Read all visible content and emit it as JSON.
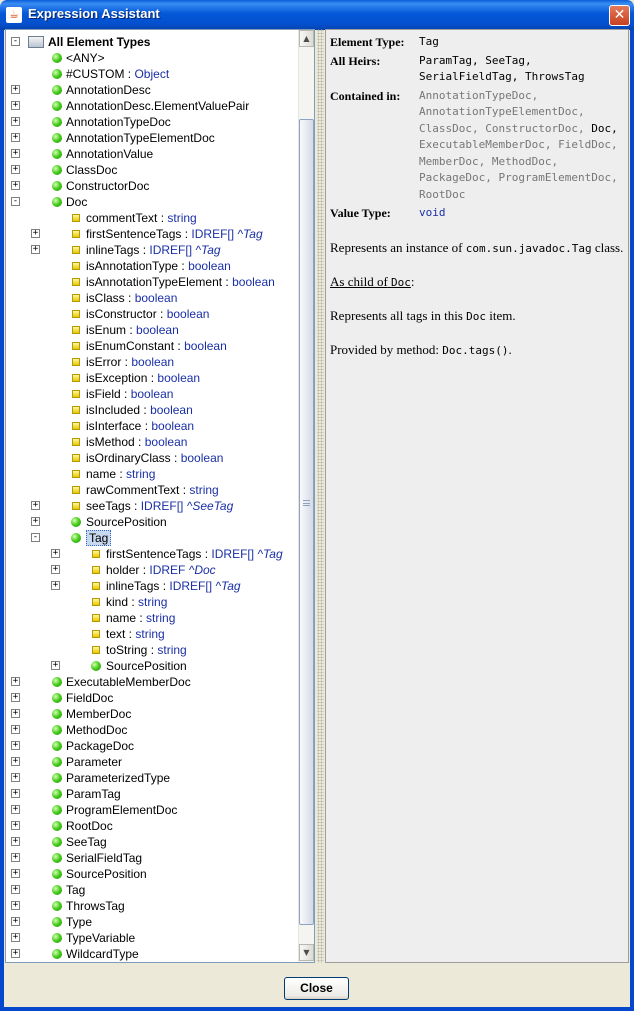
{
  "window": {
    "title": "Expression Assistant",
    "close_glyph": "✕"
  },
  "tree": {
    "root_label": "All Element Types",
    "rows": [
      {
        "indent": 1,
        "icon": "dot",
        "exp": "",
        "name": "<ANY>",
        "type": ""
      },
      {
        "indent": 1,
        "icon": "dot",
        "exp": "",
        "name": "#CUSTOM",
        "type": "Object"
      },
      {
        "indent": 1,
        "icon": "dot",
        "exp": "+",
        "name": "AnnotationDesc",
        "type": ""
      },
      {
        "indent": 1,
        "icon": "dot",
        "exp": "+",
        "name": "AnnotationDesc.ElementValuePair",
        "type": ""
      },
      {
        "indent": 1,
        "icon": "dot",
        "exp": "+",
        "name": "AnnotationTypeDoc",
        "type": ""
      },
      {
        "indent": 1,
        "icon": "dot",
        "exp": "+",
        "name": "AnnotationTypeElementDoc",
        "type": ""
      },
      {
        "indent": 1,
        "icon": "dot",
        "exp": "+",
        "name": "AnnotationValue",
        "type": ""
      },
      {
        "indent": 1,
        "icon": "dot",
        "exp": "+",
        "name": "ClassDoc",
        "type": ""
      },
      {
        "indent": 1,
        "icon": "dot",
        "exp": "+",
        "name": "ConstructorDoc",
        "type": ""
      },
      {
        "indent": 1,
        "icon": "dot",
        "exp": "-",
        "name": "Doc",
        "type": ""
      },
      {
        "indent": 2,
        "icon": "sq",
        "exp": "",
        "name": "commentText",
        "type": "string"
      },
      {
        "indent": 2,
        "icon": "sq",
        "exp": "+",
        "name": "firstSentenceTags",
        "type": "IDREF[]",
        "ref": "^Tag"
      },
      {
        "indent": 2,
        "icon": "sq",
        "exp": "+",
        "name": "inlineTags",
        "type": "IDREF[]",
        "ref": "^Tag"
      },
      {
        "indent": 2,
        "icon": "sq",
        "exp": "",
        "name": "isAnnotationType",
        "type": "boolean"
      },
      {
        "indent": 2,
        "icon": "sq",
        "exp": "",
        "name": "isAnnotationTypeElement",
        "type": "boolean"
      },
      {
        "indent": 2,
        "icon": "sq",
        "exp": "",
        "name": "isClass",
        "type": "boolean"
      },
      {
        "indent": 2,
        "icon": "sq",
        "exp": "",
        "name": "isConstructor",
        "type": "boolean"
      },
      {
        "indent": 2,
        "icon": "sq",
        "exp": "",
        "name": "isEnum",
        "type": "boolean"
      },
      {
        "indent": 2,
        "icon": "sq",
        "exp": "",
        "name": "isEnumConstant",
        "type": "boolean"
      },
      {
        "indent": 2,
        "icon": "sq",
        "exp": "",
        "name": "isError",
        "type": "boolean"
      },
      {
        "indent": 2,
        "icon": "sq",
        "exp": "",
        "name": "isException",
        "type": "boolean"
      },
      {
        "indent": 2,
        "icon": "sq",
        "exp": "",
        "name": "isField",
        "type": "boolean"
      },
      {
        "indent": 2,
        "icon": "sq",
        "exp": "",
        "name": "isIncluded",
        "type": "boolean"
      },
      {
        "indent": 2,
        "icon": "sq",
        "exp": "",
        "name": "isInterface",
        "type": "boolean"
      },
      {
        "indent": 2,
        "icon": "sq",
        "exp": "",
        "name": "isMethod",
        "type": "boolean"
      },
      {
        "indent": 2,
        "icon": "sq",
        "exp": "",
        "name": "isOrdinaryClass",
        "type": "boolean"
      },
      {
        "indent": 2,
        "icon": "sq",
        "exp": "",
        "name": "name",
        "type": "string"
      },
      {
        "indent": 2,
        "icon": "sq",
        "exp": "",
        "name": "rawCommentText",
        "type": "string"
      },
      {
        "indent": 2,
        "icon": "sq",
        "exp": "+",
        "name": "seeTags",
        "type": "IDREF[]",
        "ref": "^SeeTag"
      },
      {
        "indent": 2,
        "icon": "dot",
        "exp": "+",
        "name": "SourcePosition",
        "type": ""
      },
      {
        "indent": 2,
        "icon": "dot",
        "exp": "-",
        "name": "Tag",
        "type": "",
        "selected": true
      },
      {
        "indent": 3,
        "icon": "sq",
        "exp": "+",
        "name": "firstSentenceTags",
        "type": "IDREF[]",
        "ref": "^Tag"
      },
      {
        "indent": 3,
        "icon": "sq",
        "exp": "+",
        "name": "holder",
        "type": "IDREF",
        "ref": "^Doc"
      },
      {
        "indent": 3,
        "icon": "sq",
        "exp": "+",
        "name": "inlineTags",
        "type": "IDREF[]",
        "ref": "^Tag"
      },
      {
        "indent": 3,
        "icon": "sq",
        "exp": "",
        "name": "kind",
        "type": "string"
      },
      {
        "indent": 3,
        "icon": "sq",
        "exp": "",
        "name": "name",
        "type": "string"
      },
      {
        "indent": 3,
        "icon": "sq",
        "exp": "",
        "name": "text",
        "type": "string"
      },
      {
        "indent": 3,
        "icon": "sq",
        "exp": "",
        "name": "toString",
        "type": "string"
      },
      {
        "indent": 3,
        "icon": "dot",
        "exp": "+",
        "name": "SourcePosition",
        "type": ""
      },
      {
        "indent": 1,
        "icon": "dot",
        "exp": "+",
        "name": "ExecutableMemberDoc",
        "type": ""
      },
      {
        "indent": 1,
        "icon": "dot",
        "exp": "+",
        "name": "FieldDoc",
        "type": ""
      },
      {
        "indent": 1,
        "icon": "dot",
        "exp": "+",
        "name": "MemberDoc",
        "type": ""
      },
      {
        "indent": 1,
        "icon": "dot",
        "exp": "+",
        "name": "MethodDoc",
        "type": ""
      },
      {
        "indent": 1,
        "icon": "dot",
        "exp": "+",
        "name": "PackageDoc",
        "type": ""
      },
      {
        "indent": 1,
        "icon": "dot",
        "exp": "+",
        "name": "Parameter",
        "type": ""
      },
      {
        "indent": 1,
        "icon": "dot",
        "exp": "+",
        "name": "ParameterizedType",
        "type": ""
      },
      {
        "indent": 1,
        "icon": "dot",
        "exp": "+",
        "name": "ParamTag",
        "type": ""
      },
      {
        "indent": 1,
        "icon": "dot",
        "exp": "+",
        "name": "ProgramElementDoc",
        "type": ""
      },
      {
        "indent": 1,
        "icon": "dot",
        "exp": "+",
        "name": "RootDoc",
        "type": ""
      },
      {
        "indent": 1,
        "icon": "dot",
        "exp": "+",
        "name": "SeeTag",
        "type": ""
      },
      {
        "indent": 1,
        "icon": "dot",
        "exp": "+",
        "name": "SerialFieldTag",
        "type": ""
      },
      {
        "indent": 1,
        "icon": "dot",
        "exp": "+",
        "name": "SourcePosition",
        "type": ""
      },
      {
        "indent": 1,
        "icon": "dot",
        "exp": "+",
        "name": "Tag",
        "type": ""
      },
      {
        "indent": 1,
        "icon": "dot",
        "exp": "+",
        "name": "ThrowsTag",
        "type": ""
      },
      {
        "indent": 1,
        "icon": "dot",
        "exp": "+",
        "name": "Type",
        "type": ""
      },
      {
        "indent": 1,
        "icon": "dot",
        "exp": "+",
        "name": "TypeVariable",
        "type": ""
      },
      {
        "indent": 1,
        "icon": "dot",
        "exp": "+",
        "name": "WildcardType",
        "type": ""
      }
    ]
  },
  "doc": {
    "element_type_label": "Element Type:",
    "element_type_value": "Tag",
    "all_heirs_label": "All Heirs:",
    "all_heirs_value": "ParamTag, SeeTag, SerialFieldTag, ThrowsTag",
    "contained_in_label": "Contained in:",
    "contained_in_items": [
      "AnnotationTypeDoc",
      "AnnotationTypeElementDoc",
      "ClassDoc",
      "ConstructorDoc",
      "Doc",
      "ExecutableMemberDoc",
      "FieldDoc",
      "MemberDoc",
      "MethodDoc",
      "PackageDoc",
      "ProgramElementDoc",
      "RootDoc"
    ],
    "contained_in_highlight": "Doc",
    "value_type_label": "Value Type:",
    "value_type_value": "void",
    "p1_prefix": "Represents an instance of",
    "p1_code": "com.sun.javadoc.Tag",
    "p1_suffix": "class.",
    "p2_prefix": "As child of",
    "p2_code": "Doc",
    "p2_suffix": ":",
    "p3_prefix": "Represents all tags in this",
    "p3_code": "Doc",
    "p3_suffix": "item.",
    "p4_prefix": "Provided by method:",
    "p4_code": "Doc.tags()",
    "p4_suffix": "."
  },
  "buttons": {
    "close_label": "Close"
  }
}
